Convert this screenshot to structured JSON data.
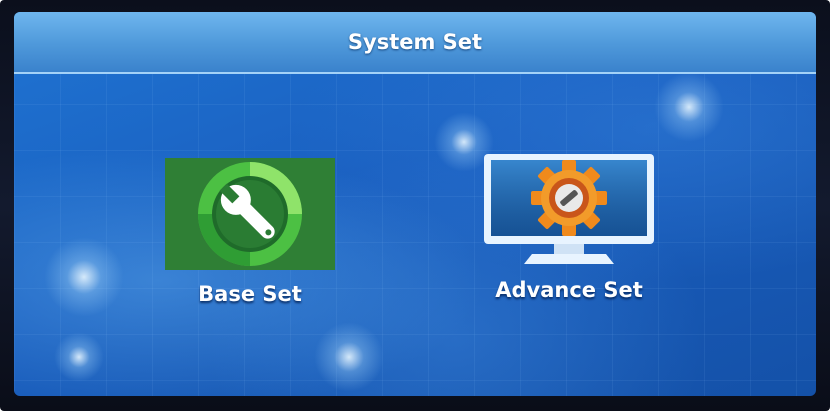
{
  "header": {
    "title": "System Set"
  },
  "menu": {
    "items": [
      {
        "label": "Base Set",
        "icon": "wrench-icon"
      },
      {
        "label": "Advance Set",
        "icon": "gear-monitor-icon"
      }
    ]
  },
  "colors": {
    "background": "#1a5fc0",
    "title_bar": "#4e98da",
    "base_icon": "#3fae3a",
    "advance_gear": "#f08a1c",
    "text": "#ffffff"
  }
}
